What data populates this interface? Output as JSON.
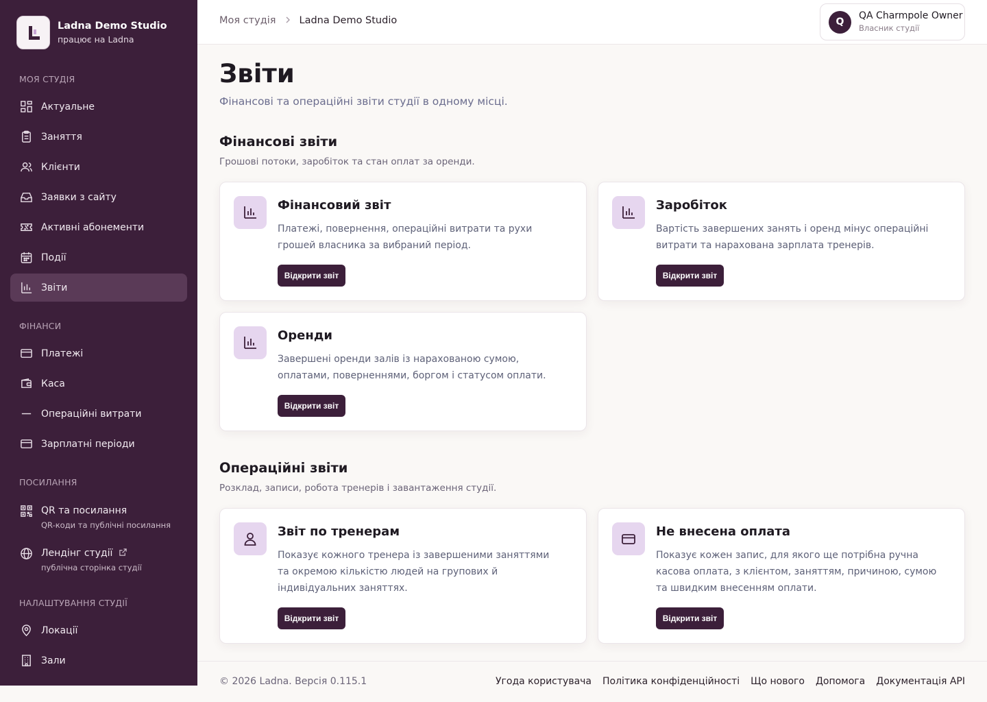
{
  "brand": {
    "name": "Ladna Demo Studio",
    "subtitle": "працює на Ladna"
  },
  "sidebar": {
    "sections": [
      {
        "label": "Моя студія"
      },
      {
        "label": "Фінанси"
      },
      {
        "label": "Посилання"
      },
      {
        "label": "Налаштування студії"
      }
    ],
    "items": [
      {
        "label": "Актуальне",
        "icon": "dashboard-icon"
      },
      {
        "label": "Заняття",
        "icon": "clipboard-icon"
      },
      {
        "label": "Клієнти",
        "icon": "users-icon"
      },
      {
        "label": "Заявки з сайту",
        "icon": "inbox-icon"
      },
      {
        "label": "Активні абонементи",
        "icon": "ticket-icon"
      },
      {
        "label": "Події",
        "icon": "calendar-icon"
      },
      {
        "label": "Звіти",
        "icon": "bar-chart-icon",
        "active": true
      },
      {
        "label": "Платежі",
        "icon": "card-icon"
      },
      {
        "label": "Каса",
        "icon": "wallet-icon"
      },
      {
        "label": "Операційні витрати",
        "icon": "minus-icon"
      },
      {
        "label": "Зарплатні періоди",
        "icon": "card-icon"
      },
      {
        "label": "QR та посилання",
        "sub": "QR-коди та публічні посилання",
        "icon": "qr-icon"
      },
      {
        "label": "Лендінг студії",
        "sub": "публічна сторінка студії",
        "icon": "globe-icon"
      },
      {
        "label": "Локації",
        "icon": "map-pin-icon"
      },
      {
        "label": "Зали",
        "icon": "building-icon"
      }
    ]
  },
  "breadcrumb": {
    "parent": "Моя студія",
    "current": "Ladna Demo Studio"
  },
  "user": {
    "initial": "Q",
    "name": "QA Charmpole Owner",
    "role": "Власник студії"
  },
  "page": {
    "title": "Звіти",
    "subtitle": "Фінансові та операційні звіти студії в одному місці."
  },
  "financial": {
    "title": "Фінансові звіти",
    "subtitle": "Грошові потоки, заробіток та стан оплат за оренди.",
    "cards": [
      {
        "title": "Фінансовий звіт",
        "desc": "Платежі, повернення, операційні витрати та рухи грошей власника за вибраний період.",
        "button": "Відкрити звіт",
        "icon": "bar-chart-icon"
      },
      {
        "title": "Заробіток",
        "desc": "Вартість завершених занять і оренд мінус операційні витрати та нарахована зарплата тренерів.",
        "button": "Відкрити звіт",
        "icon": "bar-chart-icon"
      },
      {
        "title": "Оренди",
        "desc": "Завершені оренди залів із нарахованою сумою, оплатами, поверненнями, боргом і статусом оплати.",
        "button": "Відкрити звіт",
        "icon": "bar-chart-icon"
      }
    ]
  },
  "operational": {
    "title": "Операційні звіти",
    "subtitle": "Розклад, записи, робота тренерів і завантаження студії.",
    "cards": [
      {
        "title": "Звіт по тренерам",
        "desc": "Показує кожного тренера із завершеними заняттями та окремою кількістю людей на групових й індивідуальних заняттях.",
        "button": "Відкрити звіт",
        "icon": "user-icon"
      },
      {
        "title": "Не внесена оплата",
        "desc": "Показує кожен запис, для якого ще потрібна ручна касова оплата, з клієнтом, заняттям, причиною, сумою та швидким внесенням оплати.",
        "button": "Відкрити звіт",
        "icon": "card-icon"
      }
    ]
  },
  "footer": {
    "copyright": "© 2026 Ladna. Версія 0.115.1",
    "links": [
      "Угода користувача",
      "Політика конфіденційності",
      "Що нового",
      "Допомога",
      "Документація API"
    ]
  },
  "colors": {
    "sidebar_bg": "#3c1f3a",
    "accent": "#3c1f3a",
    "icon_tile": "#e6d6ef"
  }
}
